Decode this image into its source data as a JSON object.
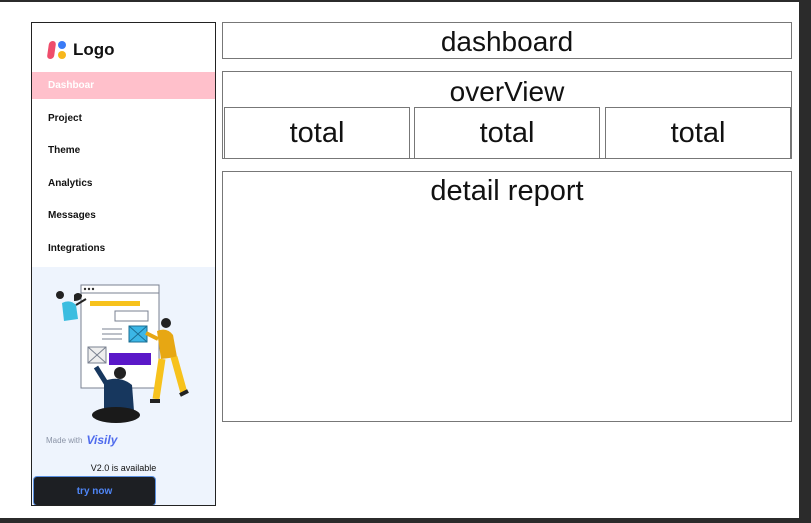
{
  "sidebar": {
    "logo_text": "Logo",
    "nav_items": [
      {
        "label": "Dashboar",
        "active": true
      },
      {
        "label": "Project",
        "active": false
      },
      {
        "label": "Theme",
        "active": false
      },
      {
        "label": "Analytics",
        "active": false
      },
      {
        "label": "Messages",
        "active": false
      },
      {
        "label": "Integrations",
        "active": false
      }
    ],
    "promo": {
      "made_with_label": "Made with",
      "brand_name": "Visily",
      "version_text": "V2.0 is available",
      "button_label": "try now"
    }
  },
  "main": {
    "dashboard_title": "dashboard",
    "overview_title": "overView",
    "totals": [
      "total",
      "total",
      "total"
    ],
    "detail_title": "detail report"
  },
  "colors": {
    "active_nav_bg": "#ffc0cb",
    "promo_bg": "#eef4fd",
    "button_bg": "#1d1f23",
    "button_text": "#4f86f7",
    "logo_red": "#ef4d6b",
    "logo_blue": "#3b7bf6",
    "logo_yellow": "#f7b71c"
  }
}
